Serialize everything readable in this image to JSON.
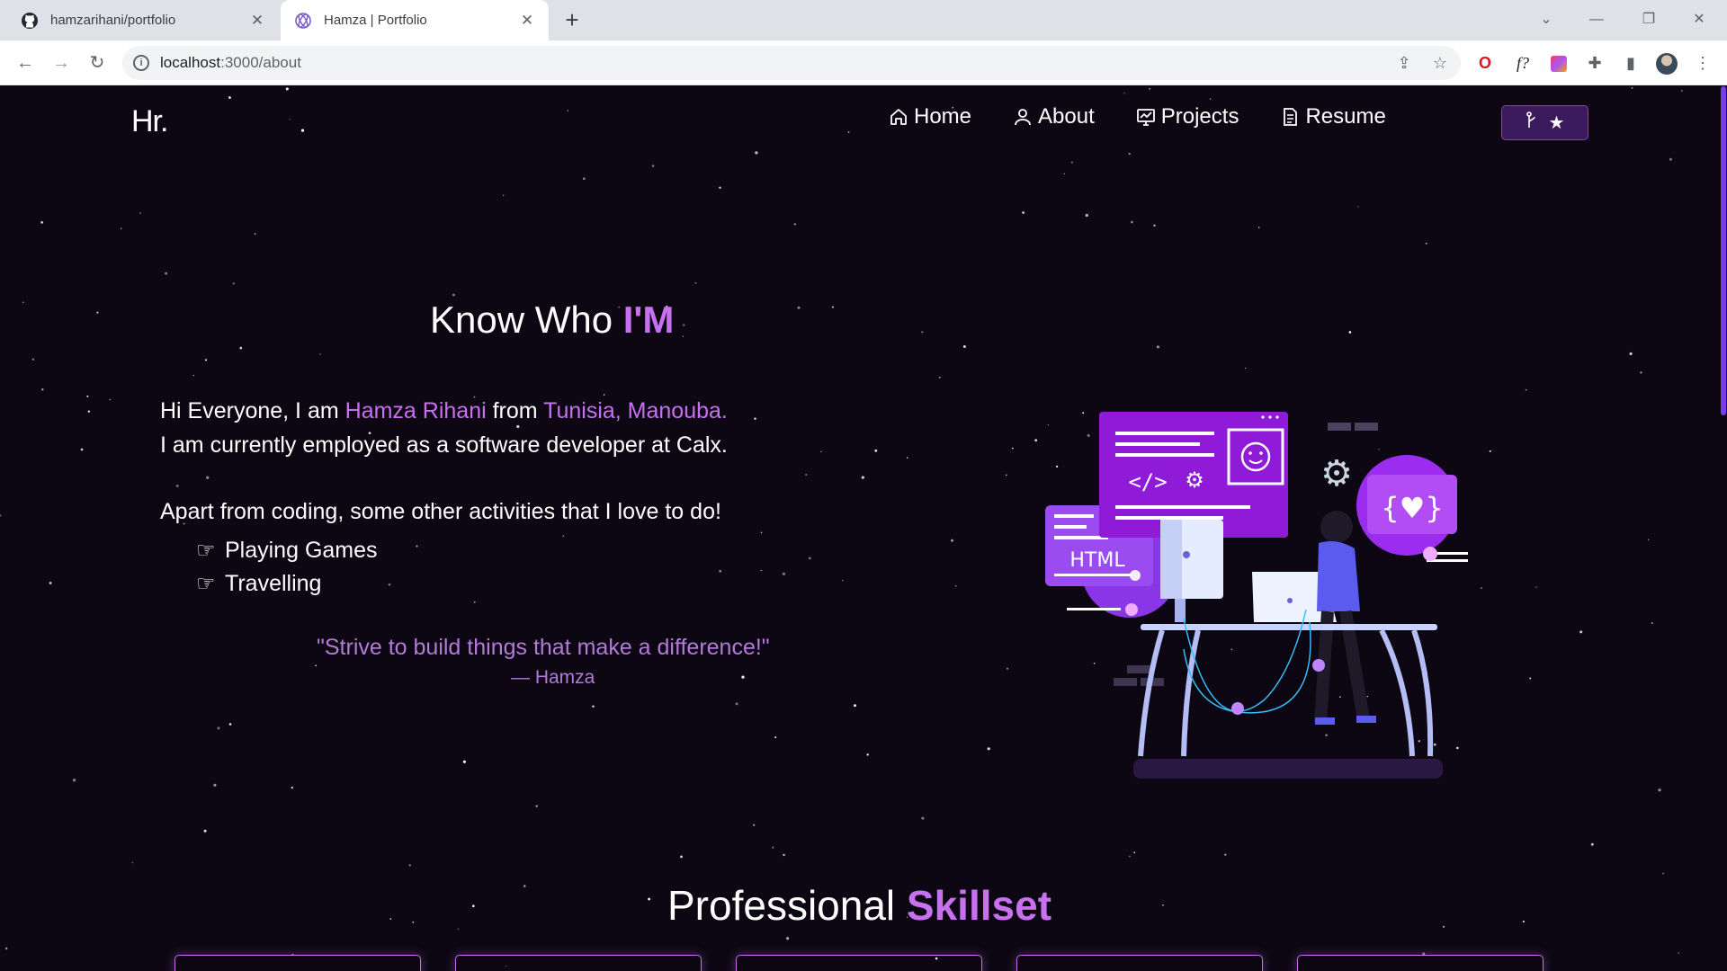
{
  "browser": {
    "tabs": [
      {
        "title": "hamzarihani/portfolio",
        "icon": "github-icon",
        "active": false
      },
      {
        "title": "Hamza | Portfolio",
        "icon": "portfolio-logo-icon",
        "active": true
      }
    ],
    "url_host": "localhost",
    "url_path": ":3000/about"
  },
  "nav": {
    "logo": "Hr.",
    "items": [
      {
        "label": "Home",
        "icon": "home-icon"
      },
      {
        "label": "About",
        "icon": "user-icon"
      },
      {
        "label": "Projects",
        "icon": "projects-icon"
      },
      {
        "label": "Resume",
        "icon": "document-icon"
      }
    ],
    "fork_button_icons": [
      "git-fork-icon",
      "star-icon"
    ]
  },
  "about": {
    "title_prefix": "Know Who ",
    "title_accent": "I'M",
    "intro_1": "Hi Everyone, I am ",
    "name": "Hamza Rihani",
    "intro_2": " from ",
    "location": "Tunisia, Manouba.",
    "job_line": "I am currently employed as a software developer at Calx.",
    "activities_intro": "Apart from coding, some other activities that I love to do!",
    "hobbies": [
      "Playing Games",
      "Travelling"
    ],
    "quote": "\"Strive to build things that make a difference!\"",
    "quote_author": "— Hamza"
  },
  "skills": {
    "title_prefix": "Professional ",
    "title_accent": "Skillset"
  },
  "illustration": {
    "html_label": "HTML"
  },
  "colors": {
    "background": "#0c0713",
    "accent": "#c770f0",
    "quote": "#b47ad8",
    "button_bg": "#3b1b5e"
  }
}
